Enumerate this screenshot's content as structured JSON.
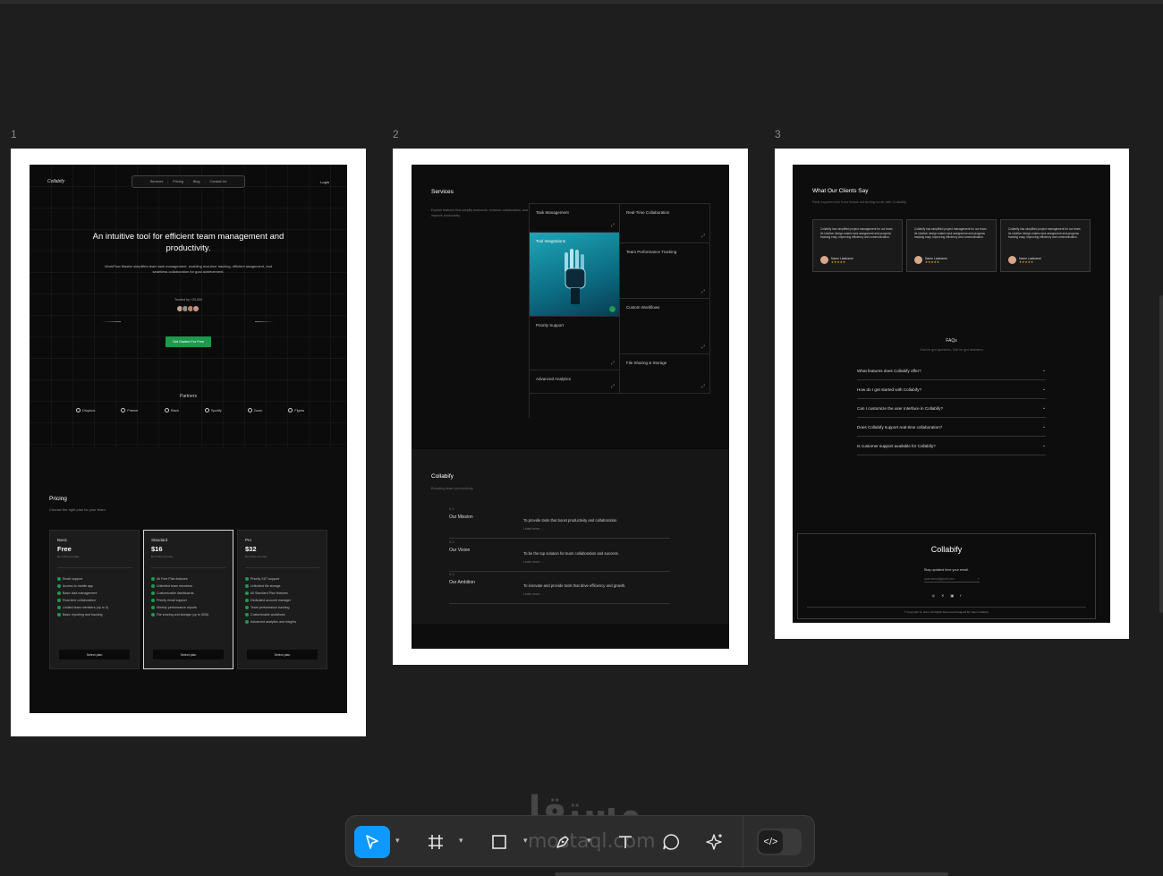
{
  "frames": {
    "f1_num": "1",
    "f2_num": "2",
    "f3_num": "3"
  },
  "landing": {
    "logo": "Collabify",
    "nav": [
      "Services",
      "Pricing",
      "Blog",
      "Contact Us"
    ],
    "login": "Login",
    "title": "An intuitive tool for efficient team management and productivity.",
    "subtitle": "WorkFlow Master simplifies team task management, enabling real-time tracking, efficient assignment, and seamless collaboration for goal achievement.",
    "trusted": "Trusted by +20,000",
    "cta": "Get Started For Free",
    "partners_title": "Partners",
    "partners": [
      "Dropbox",
      "Framer",
      "Slack",
      "Spotify",
      "Zoom",
      "Figma"
    ]
  },
  "pricing": {
    "title": "Pricing",
    "subtitle": "Choose the right plan for your team",
    "plans": [
      {
        "name": "Basic",
        "price": "Free",
        "billing": "$0 (USD) annually",
        "features": [
          "Email support",
          "Access to mobile app",
          "Basic task management",
          "Real-time collaboration",
          "Limited team members (up to 3)",
          "Basic reporting and tracking"
        ],
        "button": "Select plan"
      },
      {
        "name": "Standard",
        "price": "$16",
        "billing": "$0 (USD) annually",
        "features": [
          "All Free Plan features",
          "Unlimited team members",
          "Customizable dashboards",
          "Priority email support",
          "Weekly performance reports",
          "File sharing and storage (up to 5GB)"
        ],
        "button": "Select plan"
      },
      {
        "name": "Pro",
        "price": "$32",
        "billing": "$0 (USD) annually",
        "features": [
          "Priority 24/7 support",
          "Unlimited file storage",
          "All Standard Plan features",
          "Dedicated account manager",
          "Team performance tracking",
          "Customizable workflows",
          "Advanced analytics and insights"
        ],
        "button": "Select plan"
      }
    ]
  },
  "services": {
    "title": "Services",
    "description": "Explore features that simplify teamwork, enhance collaboration, and improve productivity.",
    "cells": [
      "Task Management",
      "Real-Time Collaboration",
      "Tool Integrations",
      "Team Performance Tracking",
      "Custom Workflows",
      "Priority Support",
      "File Sharing & Storage",
      "Advanced Analytics"
    ]
  },
  "about": {
    "title": "Collabify",
    "subtitle": "Boosting team productivity",
    "rows": [
      {
        "num": "0.1",
        "title": "Our Mission",
        "desc": "To provide tools that boost productivity and collaboration.",
        "link": "Learn more →"
      },
      {
        "num": "0.2",
        "title": "Our Vision",
        "desc": "To be the top solution for team collaboration and success.",
        "link": "Learn more →"
      },
      {
        "num": "0.3",
        "title": "Our Ambition",
        "desc": "To innovate and provide tools that drive efficiency and growth.",
        "link": "Learn more →"
      }
    ]
  },
  "testimonials": {
    "title": "What Our Clients Say",
    "subtitle": "Real experiences from teams achieving more with Collabify.",
    "quote": "Collabify has simplified project management for our team. Its intuitive design makes task assignment and progress tracking easy, improving efficiency and communication.",
    "name": "Name Lastname",
    "stars": "★★★★★"
  },
  "faq": {
    "title": "FAQs",
    "subtitle": "You've got question, We've got answers",
    "items": [
      "What features does Collabify offer?",
      "How do I get started with Collabify?",
      "Can I customize the user interface in Collabify?",
      "Does Collabify support real-time collaboration?",
      "Is customer support available for Collabify?"
    ]
  },
  "footer": {
    "logo": "Collabify",
    "stay": "Stay updated time your email.",
    "email_placeholder": "username@gmail.com",
    "copyright": "© Copyright by Homu All Rights Reserved Designed By Team Collabify"
  },
  "watermark": {
    "arabic": "مستقل",
    "latin": "mostaql.com"
  },
  "colors": {
    "accent": "#0d99ff",
    "green": "#1d9a4e",
    "canvas": "#1e1e1e"
  }
}
